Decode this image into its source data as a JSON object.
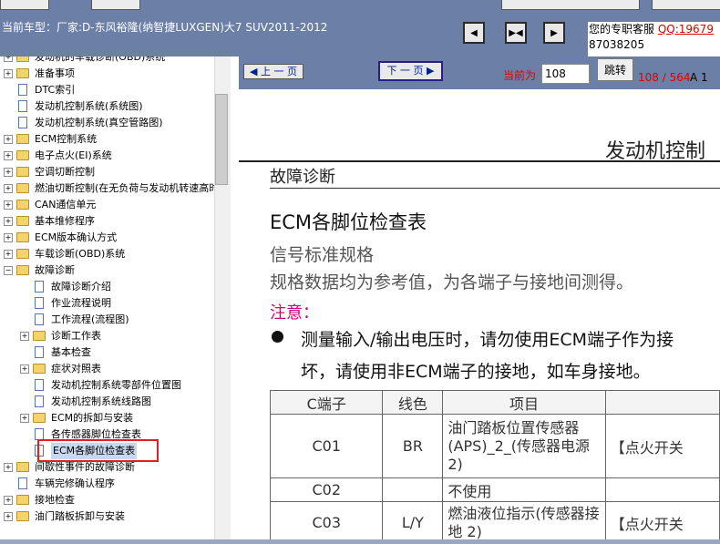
{
  "header": {
    "car_model": "当前车型：厂家:D-东风裕隆(纳智捷LUXGEN)大7 SUV2011-2012",
    "service_line1": "您的专职客服",
    "service_qq": "QQ:19679",
    "service_line2": "87038205",
    "nav_icons": [
      "first-page-icon",
      "fit-width-icon",
      "last-page-icon"
    ]
  },
  "tree": {
    "items": [
      {
        "label": "发动机的车载诊断(OBD)系统",
        "type": "folder",
        "level": 0
      },
      {
        "label": "准备事项",
        "type": "folder",
        "level": 0
      },
      {
        "label": "DTC索引",
        "type": "doc",
        "level": 0
      },
      {
        "label": "发动机控制系统(系统图)",
        "type": "doc",
        "level": 0
      },
      {
        "label": "发动机控制系统(真空管路图)",
        "type": "doc",
        "level": 0
      },
      {
        "label": "ECM控制系统",
        "type": "folder",
        "level": 0
      },
      {
        "label": "电子点火(EI)系统",
        "type": "folder",
        "level": 0
      },
      {
        "label": "空调切断控制",
        "type": "folder",
        "level": 0
      },
      {
        "label": "燃油切断控制(在无负荷与发动机转速高时",
        "type": "folder",
        "level": 0
      },
      {
        "label": "CAN通信单元",
        "type": "folder",
        "level": 0
      },
      {
        "label": "基本维修程序",
        "type": "folder",
        "level": 0
      },
      {
        "label": "ECM版本确认方式",
        "type": "folder",
        "level": 0
      },
      {
        "label": "车载诊断(OBD)系统",
        "type": "folder",
        "level": 0
      },
      {
        "label": "故障诊断",
        "type": "folder-open",
        "level": 0
      },
      {
        "label": "故障诊断介绍",
        "type": "doc",
        "level": 1
      },
      {
        "label": "作业流程说明",
        "type": "doc",
        "level": 1
      },
      {
        "label": "工作流程(流程图)",
        "type": "doc",
        "level": 1
      },
      {
        "label": "诊断工作表",
        "type": "folder",
        "level": 1
      },
      {
        "label": "基本检查",
        "type": "doc",
        "level": 1
      },
      {
        "label": "症状对照表",
        "type": "folder",
        "level": 1
      },
      {
        "label": "发动机控制系统零部件位置图",
        "type": "doc",
        "level": 1
      },
      {
        "label": "发动机控制系统线路图",
        "type": "doc",
        "level": 1
      },
      {
        "label": "ECM的拆卸与安装",
        "type": "folder",
        "level": 1
      },
      {
        "label": "各传感器脚位检查表",
        "type": "doc",
        "level": 1
      },
      {
        "label": "ECM各脚位检查表",
        "type": "doc",
        "level": 1,
        "selected": true
      },
      {
        "label": "间歇性事件的故障诊断",
        "type": "folder",
        "level": 0
      },
      {
        "label": "车辆完修确认程序",
        "type": "doc",
        "level": 0
      },
      {
        "label": "接地检查",
        "type": "folder",
        "level": 0
      },
      {
        "label": "油门踏板拆卸与安装",
        "type": "folder",
        "level": 0
      }
    ]
  },
  "pager": {
    "prev_label": "上 一 页",
    "next_label": "下 一 页",
    "current_label": "当前为",
    "current_page": "108",
    "jump_label": "跳转",
    "page_count": "108 / 564",
    "page_suffix": "A 1"
  },
  "document": {
    "heading_right": "发动机控制",
    "section": "故障诊断",
    "title": "ECM各脚位检查表",
    "subtitle": "信号标准规格",
    "description": "规格数据均为参考值，为各端子与接地间测得。",
    "note_label": "注意：",
    "bullet_line1": "测量输入/输出电压时，请勿使用ECM端子作为接",
    "bullet_line2": "坏，请使用非ECM端子的接地，如车身接地。",
    "table": {
      "headers": [
        "C端子",
        "线色",
        "项目",
        ""
      ],
      "rows": [
        {
          "terminal": "C01",
          "color": "BR",
          "item": "油门踏板位置传感器(APS)_2_(传感器电源2)",
          "condition": "【点火开关"
        },
        {
          "terminal": "C02",
          "color": "",
          "item": "不使用",
          "condition": ""
        },
        {
          "terminal": "C03",
          "color": "L/Y",
          "item": "燃油液位指示(传感器接地 2)",
          "condition": "【点火开关"
        }
      ]
    }
  }
}
